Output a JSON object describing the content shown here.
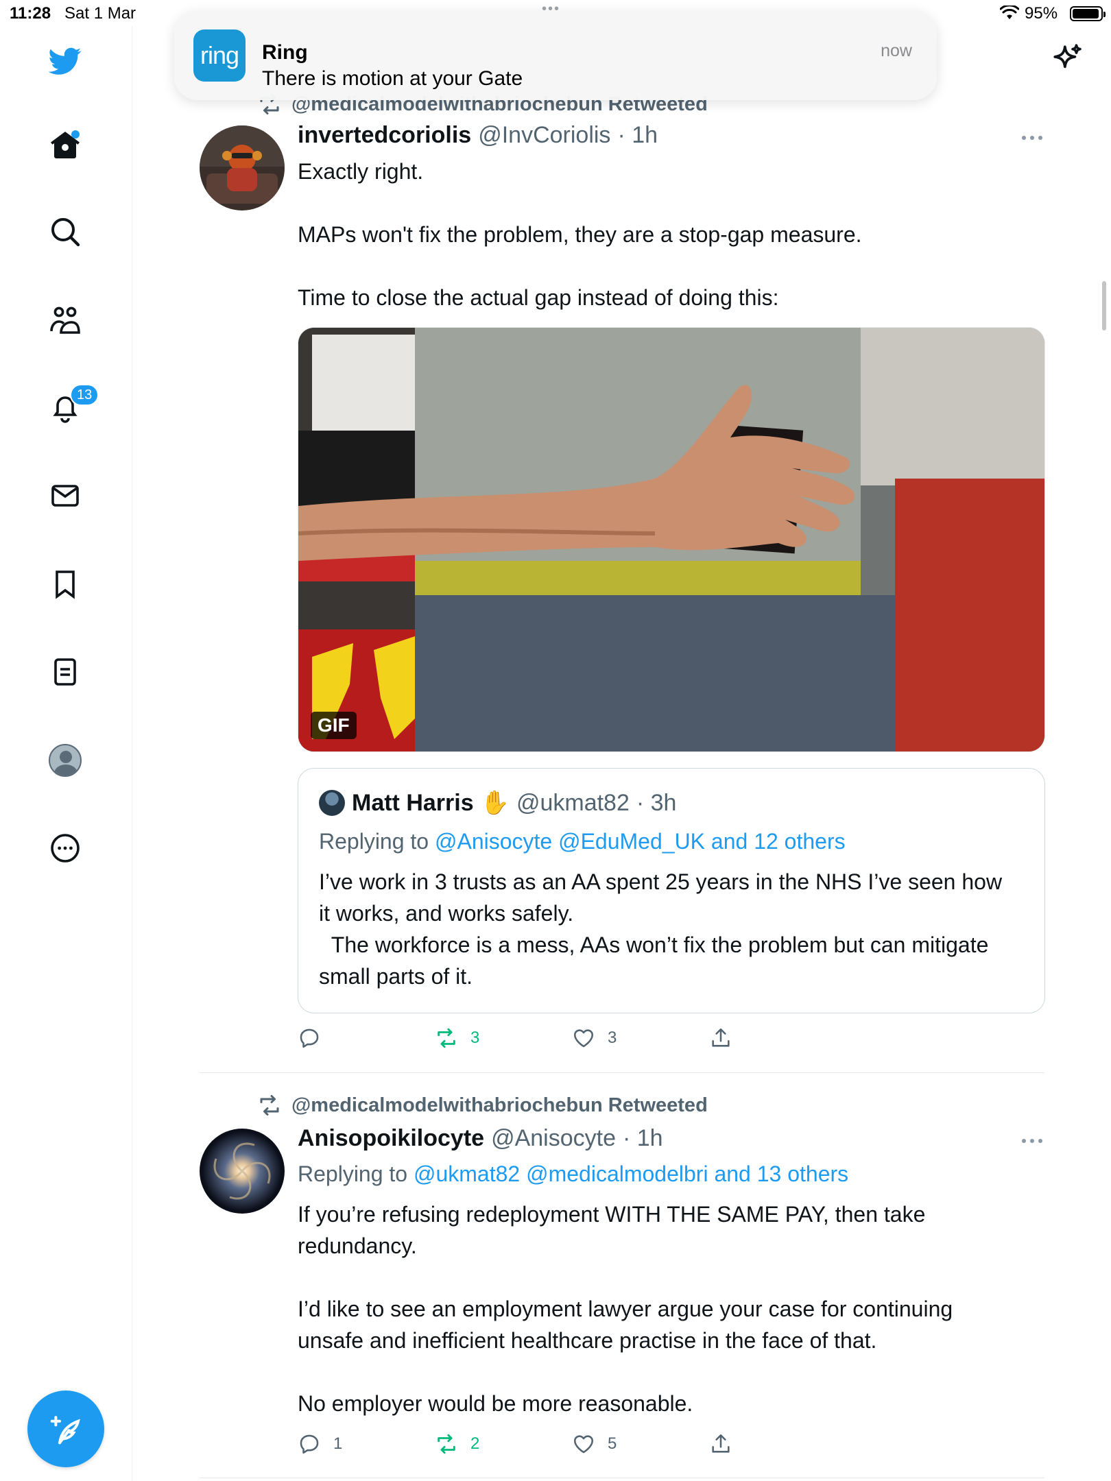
{
  "status_bar": {
    "time": "11:28",
    "date": "Sat 1 Mar",
    "battery": "95%"
  },
  "notification": {
    "app_icon_text": "ring",
    "app": "Ring",
    "message": "There is motion at your Gate",
    "when": "now"
  },
  "sidebar": {
    "items": [
      {
        "name": "home",
        "icon": "home-icon"
      },
      {
        "name": "explore",
        "icon": "search-icon"
      },
      {
        "name": "communities",
        "icon": "communities-icon"
      },
      {
        "name": "notifications",
        "icon": "bell-icon",
        "badge": "13"
      },
      {
        "name": "messages",
        "icon": "mail-icon"
      },
      {
        "name": "bookmarks",
        "icon": "bookmark-icon"
      },
      {
        "name": "lists",
        "icon": "list-icon"
      },
      {
        "name": "profile",
        "icon": "avatar"
      },
      {
        "name": "more",
        "icon": "more-circle-icon"
      }
    ],
    "compose_icon": "compose-icon"
  },
  "tweets": [
    {
      "retweeted_by": "@medicalmodelwithabriochebun Retweeted",
      "name": "invertedcoriolis",
      "handle": "@InvCoriolis",
      "time": "· 1h",
      "text": "Exactly right.\n\nMAPs won't fix the problem, they are a stop-gap measure.\n\nTime to close the actual gap instead of doing this:",
      "media_badge": "GIF",
      "quote": {
        "name": "Matt Harris",
        "emoji": "✋",
        "handle": "@ukmat82",
        "time": "· 3h",
        "replying_prefix": "Replying to ",
        "replying_to": "@Anisocyte @EduMed_UK and 12 others",
        "text": "I’ve work in 3 trusts as an AA spent 25 years in the NHS I’ve seen how it works, and works safely.\n  The workforce is a mess, AAs won’t fix the problem but can mitigate small parts of it."
      },
      "actions": {
        "replies": "",
        "retweets": "3",
        "likes": "3"
      }
    },
    {
      "retweeted_by": "@medicalmodelwithabriochebun Retweeted",
      "name": "Anisopoikilocyte",
      "handle": "@Anisocyte",
      "time": "· 1h",
      "replying_prefix": "Replying to ",
      "replying_to": "@ukmat82 @medicalmodelbri and 13 others",
      "text": "If you’re refusing redeployment WITH THE SAME PAY, then take redundancy.\n\nI’d like to see an employment lawyer argue your case for continuing unsafe and inefficient healthcare practise in the face of that.\n\nNo employer would be more reasonable.",
      "actions": {
        "replies": "1",
        "retweets": "2",
        "likes": "5"
      }
    }
  ],
  "colors": {
    "accent": "#1d9bf0",
    "retweet_green": "#00ba7c",
    "secondary_text": "#536471",
    "ring_blue": "#1998d5"
  }
}
